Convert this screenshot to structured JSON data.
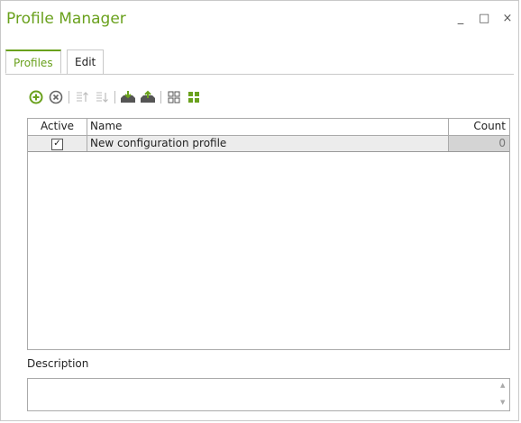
{
  "window": {
    "title": "Profile Manager",
    "controls": [
      "_",
      "□",
      "×"
    ]
  },
  "accent_color": "#6aa11d",
  "tabs": [
    {
      "label": "Profiles",
      "active": true
    },
    {
      "label": "Edit",
      "active": false
    }
  ],
  "toolbar": {
    "icons": [
      "add-icon",
      "remove-icon",
      "move-up-icon",
      "move-down-icon",
      "import-icon",
      "export-icon",
      "view-grid-icon",
      "view-tiles-icon"
    ]
  },
  "grid": {
    "columns": [
      "Active",
      "Name",
      "Count"
    ],
    "rows": [
      {
        "active": true,
        "name": "New configuration profile",
        "count": "0"
      }
    ]
  },
  "description": {
    "label": "Description",
    "value": ""
  }
}
